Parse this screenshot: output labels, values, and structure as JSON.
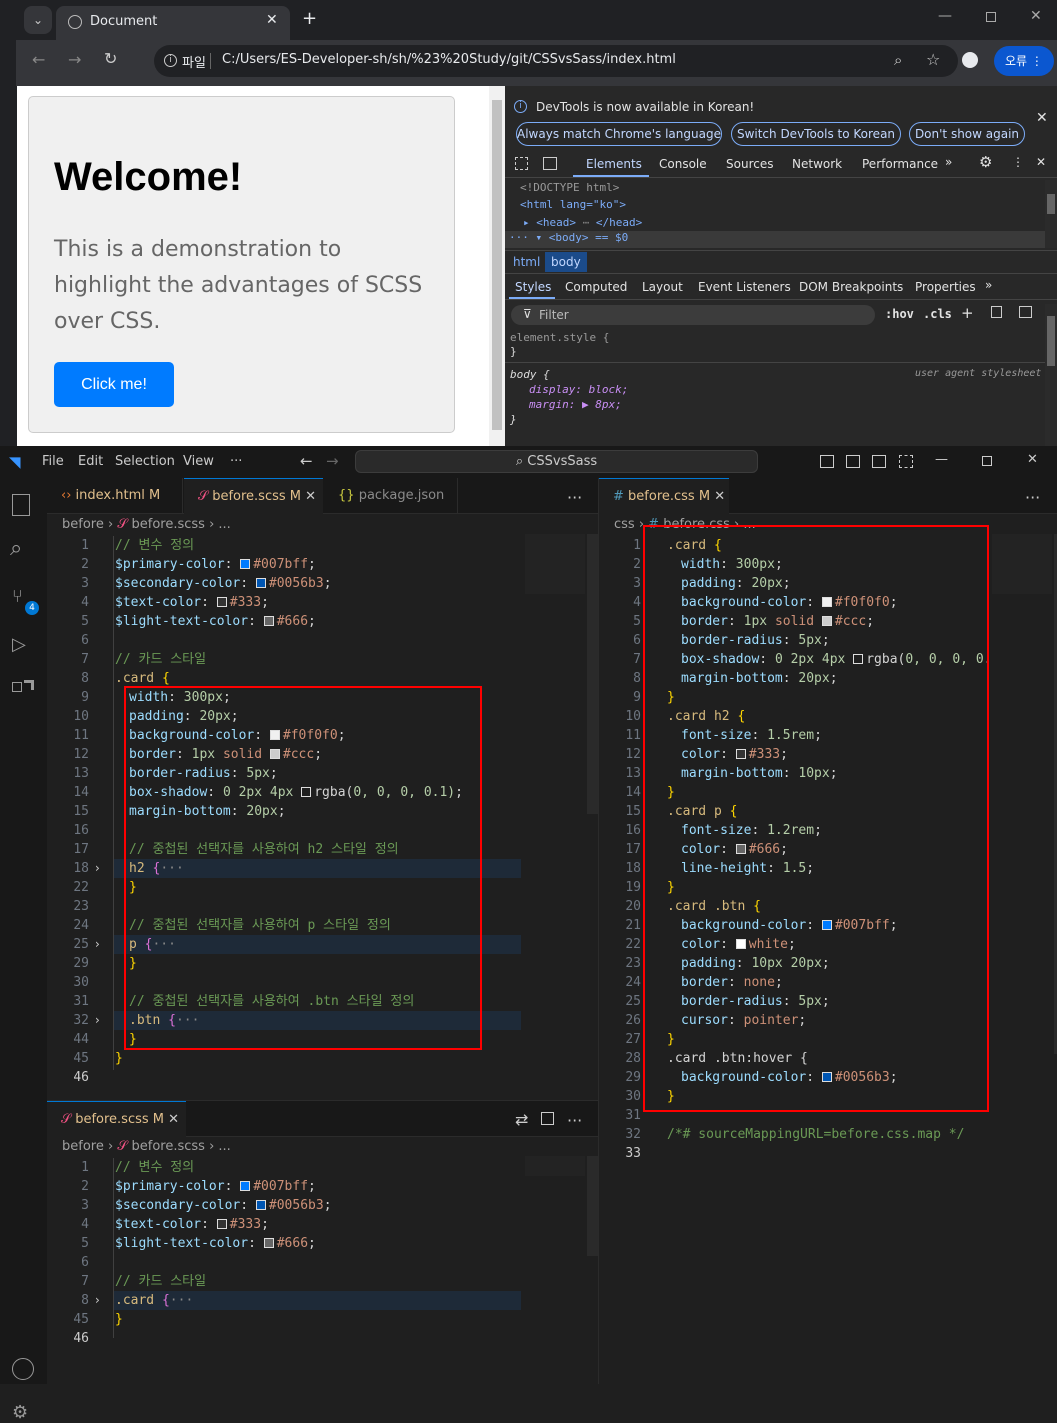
{
  "browser": {
    "tab_title": "Document",
    "url_prefix": "파일",
    "url": "C:/Users/ES-Developer-sh/sh/%23%20Study/git/CSSvsSass/index.html",
    "profile_button": "오류"
  },
  "page": {
    "heading": "Welcome!",
    "paragraph": "This is a demonstration to highlight the advantages of SCSS over CSS.",
    "button": "Click me!"
  },
  "devtools": {
    "notice": "DevTools is now available in Korean!",
    "btn_match": "Always match Chrome's language",
    "btn_switch": "Switch DevTools to Korean",
    "btn_dont": "Don't show again",
    "tabs": [
      "Elements",
      "Console",
      "Sources",
      "Network",
      "Performance"
    ],
    "dom": [
      "<!DOCTYPE html>",
      "<html lang=\"ko\">",
      "<head>",
      "</head>",
      "<body> == $0"
    ],
    "crumbs": [
      "html",
      "body"
    ],
    "subtabs": [
      "Styles",
      "Computed",
      "Layout",
      "Event Listeners",
      "DOM Breakpoints",
      "Properties"
    ],
    "filter": "Filter",
    "hov": ":hov",
    "cls": ".cls",
    "element_style": "element.style {",
    "close_brace": "}",
    "body_rule": "body {",
    "ua": "user agent stylesheet",
    "decl1": "display: block;",
    "decl2": "margin: ▶ 8px;"
  },
  "vscode": {
    "menu": [
      "File",
      "Edit",
      "Selection",
      "View",
      "···"
    ],
    "search": "CSSvsSass",
    "badge": "4",
    "tabs_left": [
      {
        "label": "index.html",
        "mod": "M"
      },
      {
        "label": "before.scss",
        "mod": "M"
      },
      {
        "label": "package.json",
        "mod": ""
      }
    ],
    "tab_right": {
      "label": "before.css",
      "mod": "M"
    },
    "tab_bottom": {
      "label": "before.scss",
      "mod": "M"
    },
    "crumb_left": [
      "before",
      "before.scss",
      "..."
    ],
    "crumb_right": [
      "css",
      "before.css",
      "..."
    ],
    "crumb_bottom": [
      "before",
      "before.scss",
      "..."
    ]
  },
  "scss_lines": [
    {
      "n": "1",
      "t": "// 변수 정의"
    },
    {
      "n": "2",
      "t": "$primary-color: #007bff;"
    },
    {
      "n": "3",
      "t": "$secondary-color: #0056b3;"
    },
    {
      "n": "4",
      "t": "$text-color: #333;"
    },
    {
      "n": "5",
      "t": "$light-text-color: #666;"
    },
    {
      "n": "6",
      "t": ""
    },
    {
      "n": "7",
      "t": "// 카드 스타일"
    },
    {
      "n": "8",
      "t": ".card {"
    },
    {
      "n": "9",
      "t": "width: 300px;"
    },
    {
      "n": "10",
      "t": "padding: 20px;"
    },
    {
      "n": "11",
      "t": "background-color: #f0f0f0;"
    },
    {
      "n": "12",
      "t": "border: 1px solid #ccc;"
    },
    {
      "n": "13",
      "t": "border-radius: 5px;"
    },
    {
      "n": "14",
      "t": "box-shadow: 0 2px 4px rgba(0, 0, 0, 0.1);"
    },
    {
      "n": "15",
      "t": "margin-bottom: 20px;"
    },
    {
      "n": "16",
      "t": ""
    },
    {
      "n": "17",
      "t": "// 중첩된 선택자를 사용하여 h2 스타일 정의"
    },
    {
      "n": "18",
      "t": "h2 {···"
    },
    {
      "n": "22",
      "t": "}"
    },
    {
      "n": "23",
      "t": ""
    },
    {
      "n": "24",
      "t": "// 중첩된 선택자를 사용하여 p 스타일 정의"
    },
    {
      "n": "25",
      "t": "p {···"
    },
    {
      "n": "29",
      "t": "}"
    },
    {
      "n": "30",
      "t": ""
    },
    {
      "n": "31",
      "t": "// 중첩된 선택자를 사용하여 .btn 스타일 정의"
    },
    {
      "n": "32",
      "t": ".btn {···"
    },
    {
      "n": "44",
      "t": "}"
    },
    {
      "n": "45",
      "t": "}"
    },
    {
      "n": "46",
      "t": ""
    }
  ],
  "css_lines": [
    {
      "n": "1",
      "t": ".card {"
    },
    {
      "n": "2",
      "t": "width: 300px;"
    },
    {
      "n": "3",
      "t": "padding: 20px;"
    },
    {
      "n": "4",
      "t": "background-color: #f0f0f0;"
    },
    {
      "n": "5",
      "t": "border: 1px solid #ccc;"
    },
    {
      "n": "6",
      "t": "border-radius: 5px;"
    },
    {
      "n": "7",
      "t": "box-shadow: 0 2px 4px rgba(0, 0, 0, 0."
    },
    {
      "n": "8",
      "t": "margin-bottom: 20px;"
    },
    {
      "n": "9",
      "t": "}"
    },
    {
      "n": "10",
      "t": ".card h2 {"
    },
    {
      "n": "11",
      "t": "font-size: 1.5rem;"
    },
    {
      "n": "12",
      "t": "color: #333;"
    },
    {
      "n": "13",
      "t": "margin-bottom: 10px;"
    },
    {
      "n": "14",
      "t": "}"
    },
    {
      "n": "15",
      "t": ".card p {"
    },
    {
      "n": "16",
      "t": "font-size: 1.2rem;"
    },
    {
      "n": "17",
      "t": "color: #666;"
    },
    {
      "n": "18",
      "t": "line-height: 1.5;"
    },
    {
      "n": "19",
      "t": "}"
    },
    {
      "n": "20",
      "t": ".card .btn {"
    },
    {
      "n": "21",
      "t": "background-color: #007bff;"
    },
    {
      "n": "22",
      "t": "color: white;"
    },
    {
      "n": "23",
      "t": "padding: 10px 20px;"
    },
    {
      "n": "24",
      "t": "border: none;"
    },
    {
      "n": "25",
      "t": "border-radius: 5px;"
    },
    {
      "n": "26",
      "t": "cursor: pointer;"
    },
    {
      "n": "27",
      "t": "}"
    },
    {
      "n": "28",
      "t": ".card .btn:hover {"
    },
    {
      "n": "29",
      "t": "background-color: #0056b3;"
    },
    {
      "n": "30",
      "t": "}"
    },
    {
      "n": "31",
      "t": ""
    },
    {
      "n": "32",
      "t": "/*# sourceMappingURL=before.css.map */"
    },
    {
      "n": "33",
      "t": ""
    }
  ],
  "bottom_lines": [
    {
      "n": "1",
      "t": "// 변수 정의"
    },
    {
      "n": "2",
      "t": "$primary-color: #007bff;"
    },
    {
      "n": "3",
      "t": "$secondary-color: #0056b3;"
    },
    {
      "n": "4",
      "t": "$text-color: #333;"
    },
    {
      "n": "5",
      "t": "$light-text-color: #666;"
    },
    {
      "n": "6",
      "t": ""
    },
    {
      "n": "7",
      "t": "// 카드 스타일"
    },
    {
      "n": "8",
      "t": ".card {···"
    },
    {
      "n": "45",
      "t": "}"
    },
    {
      "n": "46",
      "t": ""
    }
  ],
  "colors": {
    "primary": "#007bff",
    "secondary": "#0056b3",
    "text": "#333333",
    "light_text": "#666666",
    "card_bg": "#f0f0f0",
    "border": "#cccccc",
    "white": "#ffffff",
    "highlight_box": "#ff0000"
  }
}
